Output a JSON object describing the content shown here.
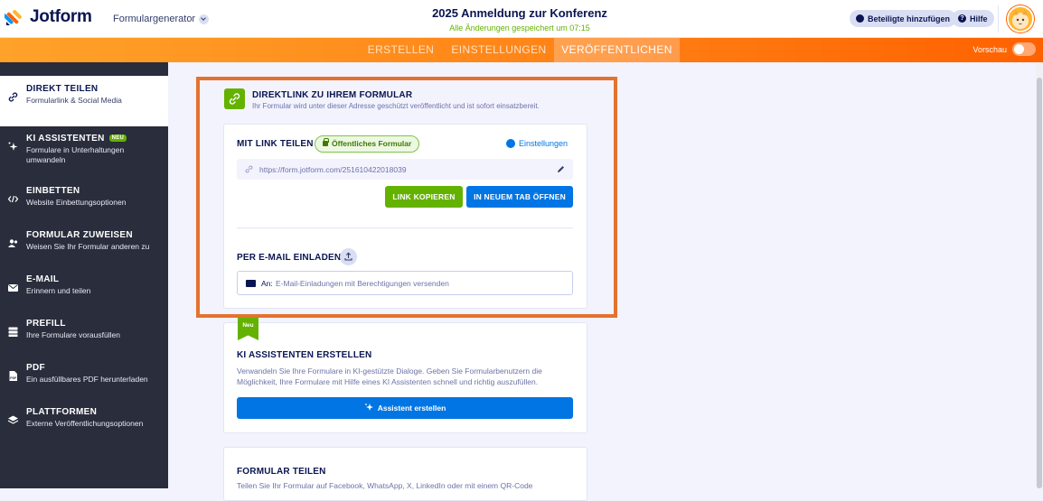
{
  "header": {
    "logo_text": "Jotform",
    "builder_label": "Formulargenerator",
    "form_title": "2025 Anmeldung zur Konferenz",
    "saved_status": "Alle Änderungen gespeichert um 07:15",
    "add_participants_label": "Beteiligte hinzufügen",
    "help_label": "Hilfe"
  },
  "nav": {
    "tabs": [
      {
        "label": "ERSTELLEN",
        "active": false
      },
      {
        "label": "EINSTELLUNGEN",
        "active": false
      },
      {
        "label": "VERÖFFENTLICHEN",
        "active": true
      }
    ],
    "preview_label": "Vorschau",
    "preview_on": false
  },
  "sidebar": {
    "items": [
      {
        "title": "DIREKT TEILEN",
        "desc": "Formularlink & Social Media",
        "icon": "link-icon",
        "active": true
      },
      {
        "title": "KI ASSISTENTEN",
        "badge": "NEU",
        "desc": "Formulare in Unterhaltungen umwandeln",
        "icon": "sparkle-icon"
      },
      {
        "title": "EINBETTEN",
        "desc": "Website Einbettungsoptionen",
        "icon": "code-icon"
      },
      {
        "title": "FORMULAR ZUWEISEN",
        "desc": "Weisen Sie Ihr Formular anderen zu",
        "icon": "users-icon"
      },
      {
        "title": "E-MAIL",
        "desc": "Erinnern und teilen",
        "icon": "envelope-icon"
      },
      {
        "title": "PREFILL",
        "desc": "Ihre Formulare vorausfüllen",
        "icon": "prefill-icon"
      },
      {
        "title": "PDF",
        "desc": "Ein ausfüllbares PDF herunterladen",
        "icon": "pdf-icon"
      },
      {
        "title": "PLATTFORMEN",
        "desc": "Externe Veröffentlichungsoptionen",
        "icon": "layers-icon"
      }
    ]
  },
  "direct_link": {
    "title": "DIREKTLINK ZU IHREM FORMULAR",
    "subtitle": "Ihr Formular wird unter dieser Adresse geschützt veröffentlicht und ist sofort einsatzbereit.",
    "share_heading": "MIT LINK TEILEN",
    "public_badge": "Öffentliches Formular",
    "settings_label": "Einstellungen",
    "url": "https://form.jotform.com/251610422018039",
    "copy_label": "LINK KOPIEREN",
    "open_label": "IN NEUEM TAB ÖFFNEN",
    "email_heading": "PER E-MAIL EINLADEN",
    "to_label": "An:",
    "email_placeholder": "E-Mail-Einladungen mit Berechtigungen versenden"
  },
  "ki_card": {
    "ribbon": "Neu",
    "title": "KI ASSISTENTEN ERSTELLEN",
    "desc": "Verwandeln Sie Ihre Formulare in KI-gestützte Dialoge. Geben Sie Formularbenutzern die Möglichkeit, Ihre Formulare mit Hilfe eines KI Assistenten schnell und richtig auszufüllen.",
    "button": "Assistent erstellen"
  },
  "share_card": {
    "title": "FORMULAR TEILEN",
    "desc": "Teilen Sie Ihr Formular auf Facebook, WhatsApp, X, LinkedIn oder mit einem QR-Code"
  },
  "colors": {
    "brand_orange": "#ff6100",
    "green": "#64b200",
    "blue": "#0075e3",
    "navy": "#0a1551",
    "sidebar_bg": "#292d3c",
    "highlight": "#e4722f"
  }
}
